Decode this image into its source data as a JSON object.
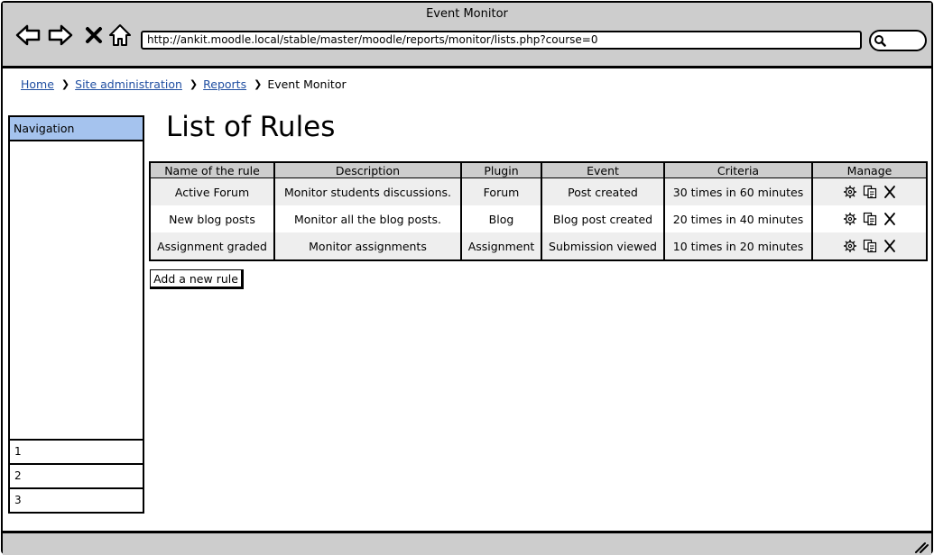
{
  "window": {
    "title": "Event Monitor"
  },
  "browser": {
    "url": "http://ankit.moodle.local/stable/master/moodle/reports/monitor/lists.php?course=0",
    "nav_icons": [
      "back-arrow-icon",
      "forward-arrow-icon",
      "close-icon",
      "home-icon"
    ],
    "search_icon": "magnifier-icon"
  },
  "breadcrumb": {
    "items": [
      "Home",
      "Site administration",
      "Reports"
    ],
    "current": "Event Monitor"
  },
  "sidebar": {
    "header": "Navigation",
    "items": [
      "1",
      "2",
      "3"
    ],
    "header_color": "#a5c3ee"
  },
  "main": {
    "title": "List of Rules",
    "table": {
      "columns": [
        "Name of the rule",
        "Description",
        "Plugin",
        "Event",
        "Criteria",
        "Manage"
      ],
      "rows": [
        {
          "name": "Active Forum",
          "description": "Monitor students discussions.",
          "plugin": "Forum",
          "event": "Post created",
          "criteria": "30 times in 60 minutes"
        },
        {
          "name": "New blog posts",
          "description": "Monitor all the blog posts.",
          "plugin": "Blog",
          "event": "Blog post created",
          "criteria": "20 times in 40 minutes"
        },
        {
          "name": "Assignment graded",
          "description": "Monitor assignments",
          "plugin": "Assignment",
          "event": "Submission viewed",
          "criteria": "10 times in 20 minutes"
        }
      ],
      "manage_icons": [
        "gear-icon",
        "copy-icon",
        "delete-x-icon"
      ]
    },
    "add_button": "Add a new rule"
  },
  "colors": {
    "chrome": "#cdcdcd",
    "link": "#1f4ea1",
    "row_alt": "#eeeeee"
  }
}
